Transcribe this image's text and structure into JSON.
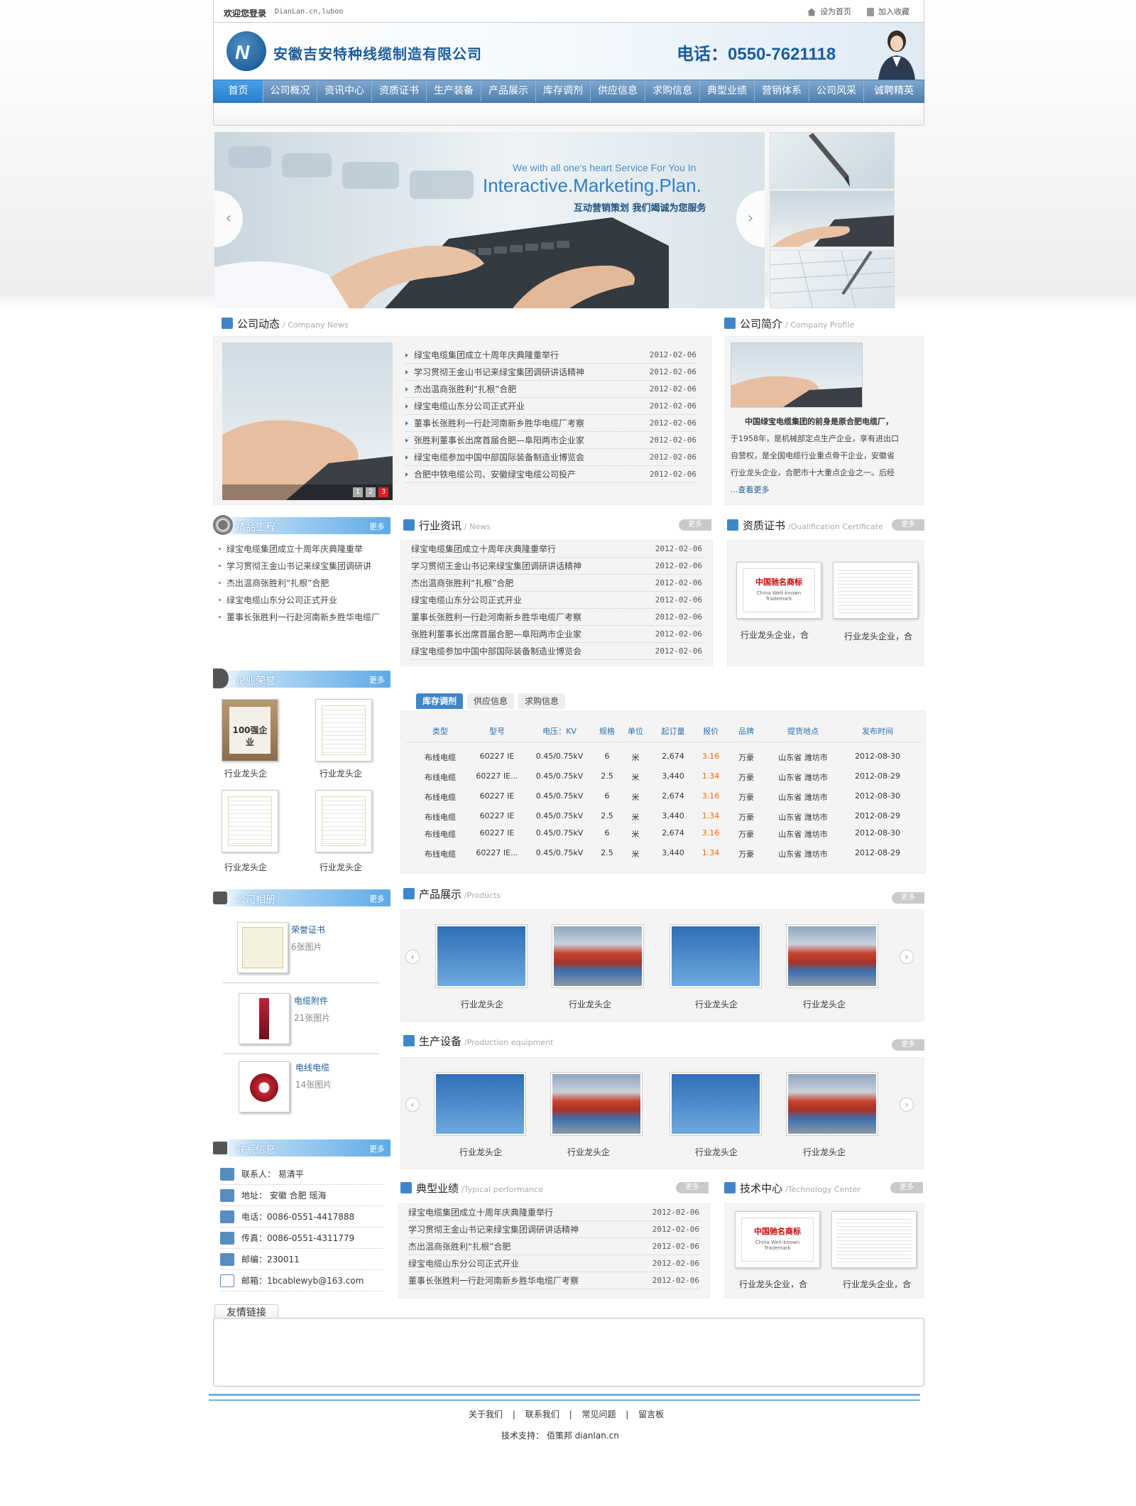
{
  "topbar": {
    "welcome": "欢迎您登录",
    "url": "DianLan.cn,luboo",
    "set_home": "设为首页",
    "add_fav": "加入收藏"
  },
  "header": {
    "company": "安徽吉安特种线缆制造有限公司",
    "phone": "电话：0550-7621118"
  },
  "nav": [
    "首页",
    "公司概况",
    "资讯中心",
    "资质证书",
    "生产装备",
    "产品展示",
    "库存调剂",
    "供应信息",
    "求购信息",
    "典型业绩",
    "营销体系",
    "公司风采",
    "诚聘精英"
  ],
  "slider": {
    "line1": "We with all one's heart Service For You In",
    "line2": "Interactive.Marketing.Plan.",
    "line3": "互动营销策划 我们竭诚为您服务"
  },
  "company_news": {
    "title": "公司动态",
    "en": "/ Company News",
    "pages": [
      "1",
      "2",
      "3"
    ],
    "items": [
      {
        "t": "绿宝电缆集团成立十周年庆典隆重举行",
        "d": "2012-02-06"
      },
      {
        "t": "学习贯彻王金山书记来绿宝集团调研讲话精神",
        "d": "2012-02-06"
      },
      {
        "t": "杰出温商张胜利“扎根”合肥",
        "d": "2012-02-06"
      },
      {
        "t": "绿宝电缆山东分公司正式开业",
        "d": "2012-02-06"
      },
      {
        "t": "董事长张胜利一行赴河南新乡胜华电缆厂考察",
        "d": "2012-02-06"
      },
      {
        "t": "张胜利董事长出席首届合肥—阜阳两市企业家",
        "d": "2012-02-06"
      },
      {
        "t": "绿宝电缆参加中国中部国际装备制造业博览会",
        "d": "2012-02-06"
      },
      {
        "t": "合肥中铁电缆公司、安徽绿宝电缆公司投产",
        "d": "2012-02-06"
      }
    ]
  },
  "profile": {
    "title": "公司简介",
    "en": "/ Company Profile",
    "lines": [
      "中国绿宝电缆集团的前身是原合肥电缆厂，",
      "于1958年，是机械部定点生产企业，享有进出口",
      "自营权，是全国电缆行业重点骨干企业，安徽省",
      "行业龙头企业，合肥市十大重点企业之一。后经"
    ],
    "more": "...查看更多"
  },
  "jingpin": {
    "title": "精品工程",
    "more": "更多",
    "items": [
      "绿宝电缆集团成立十周年庆典隆重举",
      "学习贯彻王金山书记来绿宝集团调研讲",
      "杰出温商张胜利“扎根”合肥",
      "绿宝电缆山东分公司正式开业",
      "董事长张胜利一行赴河南新乡胜华电缆厂"
    ]
  },
  "industry": {
    "title": "行业资讯",
    "en": "/ News",
    "more": "更多",
    "items": [
      {
        "t": "绿宝电缆集团成立十周年庆典隆重举行",
        "d": "2012-02-06"
      },
      {
        "t": "学习贯彻王金山书记来绿宝集团调研讲话精神",
        "d": "2012-02-06"
      },
      {
        "t": "杰出温商张胜利“扎根”合肥",
        "d": "2012-02-06"
      },
      {
        "t": "绿宝电缆山东分公司正式开业",
        "d": "2012-02-06"
      },
      {
        "t": "董事长张胜利一行赴河南新乡胜华电缆厂考察",
        "d": "2012-02-06"
      },
      {
        "t": "张胜利董事长出席首届合肥—阜阳两市企业家",
        "d": "2012-02-06"
      },
      {
        "t": "绿宝电缆参加中国中部国际装备制造业博览会",
        "d": "2012-02-06"
      }
    ]
  },
  "qualification": {
    "title": "资质证书",
    "en": "/Qualification Certificate",
    "more": "更多",
    "caps": [
      "行业龙头企业，合",
      "行业龙头企业，合"
    ],
    "cert_text": "中国驰名商标",
    "cert_en": "China Well-known Trademark"
  },
  "honor": {
    "title": "企业荣誉",
    "more": "更多",
    "caps": [
      "行业龙头企",
      "行业龙头企",
      "行业龙头企",
      "行业龙头企"
    ],
    "badge": "100强企业"
  },
  "stock": {
    "tabs": [
      "库存调剂",
      "供应信息",
      "求购信息"
    ],
    "headers": [
      "类型",
      "型号",
      "电压：KV",
      "规格",
      "单位",
      "起订量",
      "报价",
      "品牌",
      "提货地点",
      "发布时间"
    ],
    "rows": [
      [
        "布线电缆",
        "60227 IE",
        "0.45/0.75kV",
        "6",
        "米",
        "2,674",
        "3.16",
        "万豪",
        "山东省 潍坊市",
        "2012-08-30"
      ],
      [
        "布线电缆",
        "60227 IE...",
        "0.45/0.75kV",
        "2.5",
        "米",
        "3,440",
        "1.34",
        "万豪",
        "山东省 潍坊市",
        "2012-08-29"
      ],
      [
        "布线电缆",
        "60227 IE",
        "0.45/0.75kV",
        "6",
        "米",
        "2,674",
        "3.16",
        "万豪",
        "山东省 潍坊市",
        "2012-08-30"
      ],
      [
        "布线电缆",
        "60227 IE",
        "0.45/0.75kV",
        "2.5",
        "米",
        "3,440",
        "1.34",
        "万豪",
        "山东省 潍坊市",
        "2012-08-29"
      ],
      [
        "布线电缆",
        "60227 IE",
        "0.45/0.75kV",
        "6",
        "米",
        "2,674",
        "3.16",
        "万豪",
        "山东省 潍坊市",
        "2012-08-30"
      ],
      [
        "布线电缆",
        "60227 IE...",
        "0.45/0.75kV",
        "2.5",
        "米",
        "3,440",
        "1.34",
        "万豪",
        "山东省 潍坊市",
        "2012-08-29"
      ]
    ],
    "price_color": "#ff6600"
  },
  "album": {
    "title": "公司相册",
    "more": "更多",
    "items": [
      {
        "t": "荣誉证书",
        "n": "6张图片"
      },
      {
        "t": "电缆附件",
        "n": "21张图片"
      },
      {
        "t": "电线电缆",
        "n": "14张图片"
      }
    ]
  },
  "products": {
    "title": "产品展示",
    "en": "/Products",
    "more": "更多",
    "caps": [
      "行业龙头企",
      "行业龙头企",
      "行业龙头企",
      "行业龙头企"
    ]
  },
  "equipment": {
    "title": "生产设备",
    "en": "/Production equipment",
    "more": "更多",
    "caps": [
      "行业龙头企",
      "行业龙头企",
      "行业龙头企",
      "行业龙头企"
    ]
  },
  "contact": {
    "title": "联系信息",
    "more": "更多",
    "rows": [
      "联系人： 易清平",
      "地址：  安徽 合肥 瑶海",
      "电话：0086-0551-4417888",
      "传真：0086-0551-4311779",
      "邮编：230011",
      "邮箱：1bcablewyb@163.com"
    ]
  },
  "performance": {
    "title": "典型业绩",
    "en": "/Typical performance",
    "more": "更多",
    "items": [
      {
        "t": "绿宝电缆集团成立十周年庆典隆重举行",
        "d": "2012-02-06"
      },
      {
        "t": "学习贯彻王金山书记来绿宝集团调研讲话精神",
        "d": "2012-02-06"
      },
      {
        "t": "杰出温商张胜利“扎根”合肥",
        "d": "2012-02-06"
      },
      {
        "t": "绿宝电缆山东分公司正式开业",
        "d": "2012-02-06"
      },
      {
        "t": "董事长张胜利一行赴河南新乡胜华电缆厂考察",
        "d": "2012-02-06"
      }
    ]
  },
  "tech": {
    "title": "技术中心",
    "en": "/Technology Center",
    "more": "更多",
    "caps": [
      "行业龙头企业，合",
      "行业龙头企业，合"
    ]
  },
  "friend_links": {
    "title": "友情链接"
  },
  "footer": {
    "links": [
      "关于我们",
      "联系我们",
      "常见问题",
      "留言板"
    ],
    "sep": "|",
    "support": "技术支持： 佰策邦 dianlan.cn"
  },
  "colors": {
    "accent": "#3f86c9",
    "nav_active": "#2a7fcc",
    "brand": "#1a5c9c"
  }
}
